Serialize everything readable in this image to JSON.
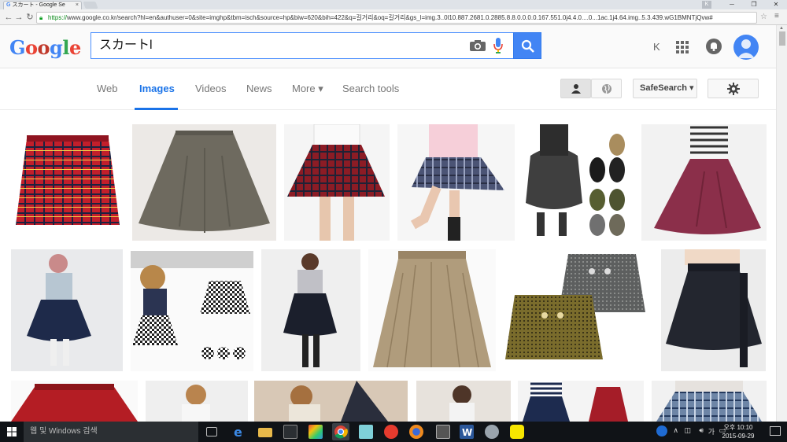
{
  "browser": {
    "tab_title": "スカート - Google Se",
    "tab_close": "×",
    "url_prefix": "https://",
    "url": "www.google.co.kr/search?hl=en&authuser=0&site=imghp&tbm=isch&source=hp&biw=620&bih=422&q=길거리&oq=길거리&gs_l=img.3..0l10.887.2681.0.2885.8.8.0.0.0.0.167.551.0j4.4.0....0...1ac.1j4.64.img..5.3.439.wG1BMNTjQvw#",
    "profile_letter": "K"
  },
  "google": {
    "logo_letters": [
      "G",
      "o",
      "o",
      "g",
      "l",
      "e"
    ],
    "logo_colors": [
      "#4285f4",
      "#ea4335",
      "#fbbc05",
      "#4285f4",
      "#34a853",
      "#ea4335"
    ],
    "search_query": "スカートl",
    "account_letter": "K"
  },
  "tabs": {
    "web": "Web",
    "images": "Images",
    "videos": "Videos",
    "news": "News",
    "more": "More ▾",
    "search_tools": "Search tools"
  },
  "controls": {
    "safesearch": "SafeSearch ▾"
  },
  "taskbar": {
    "search_placeholder": "웹 및 Windows 검색",
    "time": "오후 10:10",
    "date": "2015-09-29",
    "ime": "가"
  },
  "colors": {
    "accent": "#1a73e8",
    "search_button": "#4285f4",
    "taskbar": "#101317"
  }
}
